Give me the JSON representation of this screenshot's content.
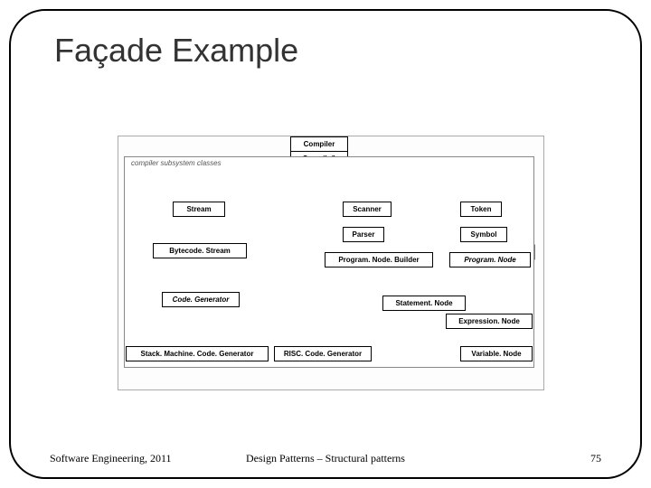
{
  "title": "Façade Example",
  "footer": {
    "left": "Software Engineering, 2011",
    "center": "Design Patterns – Structural patterns",
    "right": "75"
  },
  "subsystem_label": "compiler\nsubsystem\nclasses",
  "compiler": {
    "name": "Compiler",
    "method": "Compile()"
  },
  "boxes": {
    "stream": "Stream",
    "bytecodeStream": "Bytecode. Stream",
    "codeGenerator": "Code. Generator",
    "stackMachine": "Stack. Machine. Code. Generator",
    "riscGenerator": "RISC. Code. Generator",
    "scanner": "Scanner",
    "parser": "Parser",
    "programNodeBuilder": "Program. Node. Builder",
    "token": "Token",
    "symbol": "Symbol",
    "programNode": "Program. Node",
    "statementNode": "Statement. Node",
    "expressionNode": "Expression. Node",
    "variableNode": "Variable. Node"
  }
}
